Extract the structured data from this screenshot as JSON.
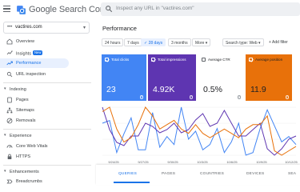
{
  "app": {
    "title": "Google Search Console"
  },
  "search": {
    "placeholder": "Inspect any URL in \"vactires.com\""
  },
  "property": {
    "dots": "•••",
    "name": "vactires.com",
    "caret": "▾"
  },
  "sidebar": {
    "items": [
      {
        "label": "Overview",
        "icon": "home-icon"
      },
      {
        "label": "Insights",
        "badge": "New",
        "icon": "insights-icon"
      },
      {
        "label": "Performance",
        "icon": "trending-up-icon",
        "active": true
      },
      {
        "label": "URL inspection",
        "icon": "search-icon"
      }
    ],
    "sections": [
      {
        "label": "Indexing",
        "items": [
          {
            "label": "Pages",
            "icon": "pages-icon"
          },
          {
            "label": "Sitemaps",
            "icon": "sitemaps-icon"
          },
          {
            "label": "Removals",
            "icon": "removals-icon"
          }
        ]
      },
      {
        "label": "Experience",
        "items": [
          {
            "label": "Core Web Vitals",
            "icon": "speedometer-icon"
          },
          {
            "label": "HTTPS",
            "icon": "lock-icon"
          }
        ]
      },
      {
        "label": "Enhancements",
        "items": [
          {
            "label": "Breadcrumbs",
            "icon": "breadcrumbs-icon"
          }
        ]
      }
    ],
    "section_caret": "▾"
  },
  "main": {
    "title": "Performance",
    "date_filters": [
      "24 hours",
      "7 days",
      "28 days",
      "3 months",
      "More"
    ],
    "selected_date_filter": "28 days",
    "check_mark": "✓",
    "more_caret": "▾",
    "search_type_filter": "Search type: Web",
    "add_filter_label": "+ Add filter"
  },
  "metrics": [
    {
      "label": "Total clicks",
      "value": "23",
      "checked": true,
      "bg": "#4285f4",
      "fg": "#ffffff"
    },
    {
      "label": "Total impressions",
      "value": "4.92K",
      "checked": true,
      "bg": "#5e35b1",
      "fg": "#ffffff"
    },
    {
      "label": "Average CTR",
      "value": "0.5%",
      "checked": false,
      "bg": "#ffffff",
      "fg": "#202124"
    },
    {
      "label": "Average position",
      "value": "11.9",
      "checked": true,
      "bg": "#e8710a",
      "fg": "#202124"
    }
  ],
  "chart_data": {
    "type": "line",
    "x_tick_labels": [
      "9/24/25",
      "9/27/25",
      "9/30/25",
      "10/3/25",
      "10/6/25",
      "10/9/25",
      "10/12/25"
    ],
    "series": [
      {
        "name": "Total clicks",
        "color": "#4285f4",
        "values": [
          1.2,
          1.3,
          0.1,
          0.8,
          1.4,
          0.2,
          0.2,
          1.6,
          0.3,
          0.7,
          0.4,
          1.8,
          0.6,
          0.9,
          0.2,
          0.4,
          1.0,
          0.1,
          0.5,
          1.2,
          0.0,
          0.1,
          1.0,
          1.7,
          1.1,
          0.5,
          0.7,
          0.4
        ]
      },
      {
        "name": "Total impressions",
        "color": "#5e35b1",
        "values": [
          0.95,
          0.6,
          0.4,
          0.35,
          0.5,
          0.5,
          0.7,
          0.65,
          0.55,
          0.6,
          0.7,
          0.55,
          0.6,
          0.75,
          0.85,
          0.65,
          0.7,
          0.9,
          0.7,
          0.5,
          0.5,
          0.6,
          0.7,
          0.3,
          0.2,
          0.3,
          0.45,
          0.5
        ]
      },
      {
        "name": "Average position",
        "color": "#e8710a",
        "values": [
          0.75,
          0.8,
          0.55,
          0.4,
          0.45,
          0.6,
          0.8,
          0.7,
          0.55,
          0.6,
          0.65,
          0.55,
          0.5,
          0.6,
          0.5,
          0.45,
          0.5,
          0.55,
          0.5,
          0.45,
          0.55,
          0.6,
          0.6,
          0.7,
          0.3,
          0.25,
          0.3,
          0.35
        ]
      }
    ]
  },
  "tabs": [
    "QUERIES",
    "PAGES",
    "COUNTRIES",
    "DEVICES",
    "SEA"
  ],
  "active_tab": "QUERIES",
  "colors": {
    "accent": "#1a73e8",
    "clicks": "#4285f4",
    "impressions": "#5e35b1",
    "position": "#e8710a"
  }
}
